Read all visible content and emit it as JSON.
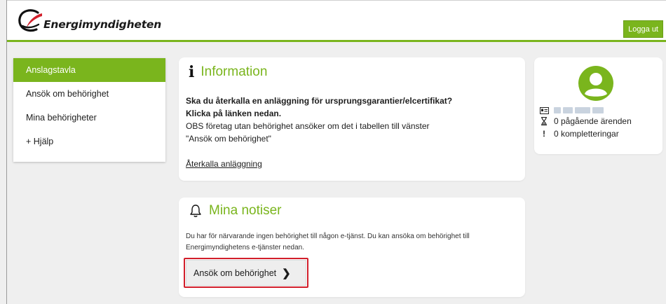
{
  "header": {
    "brand": "Energimyndigheten",
    "logout_label": "Logga ut",
    "accent": "#7ab51d"
  },
  "sidebar": {
    "items": [
      {
        "label": "Anslagstavla",
        "active": true
      },
      {
        "label": "Ansök om behörighet",
        "active": false
      },
      {
        "label": "Mina behörigheter",
        "active": false
      },
      {
        "label": "+ Hjälp",
        "active": false
      }
    ]
  },
  "info": {
    "icon": "info-icon",
    "title": "Information",
    "line1": "Ska du återkalla en anläggning för ursprungsgarantier/elcertifikat?",
    "line2": "Klicka på länken nedan.",
    "line3": "OBS företag utan behörighet ansöker om det i tabellen till vänster",
    "line4": "\"Ansök om behörighet\"",
    "link": "Återkalla anläggning"
  },
  "notices": {
    "icon": "bell-icon",
    "title": "Mina notiser",
    "text": "Du har för närvarande ingen behörighet till någon e-tjänst. Du kan ansöka om behörighet till Energimyndighetens e-tjänster nedan.",
    "button_label": "Ansök om behörighet",
    "highlight_color": "#d21f2b"
  },
  "profile": {
    "avatar_icon": "user-avatar-icon",
    "ongoing": "0 pågående ärenden",
    "completions": "0 kompletteringar"
  }
}
